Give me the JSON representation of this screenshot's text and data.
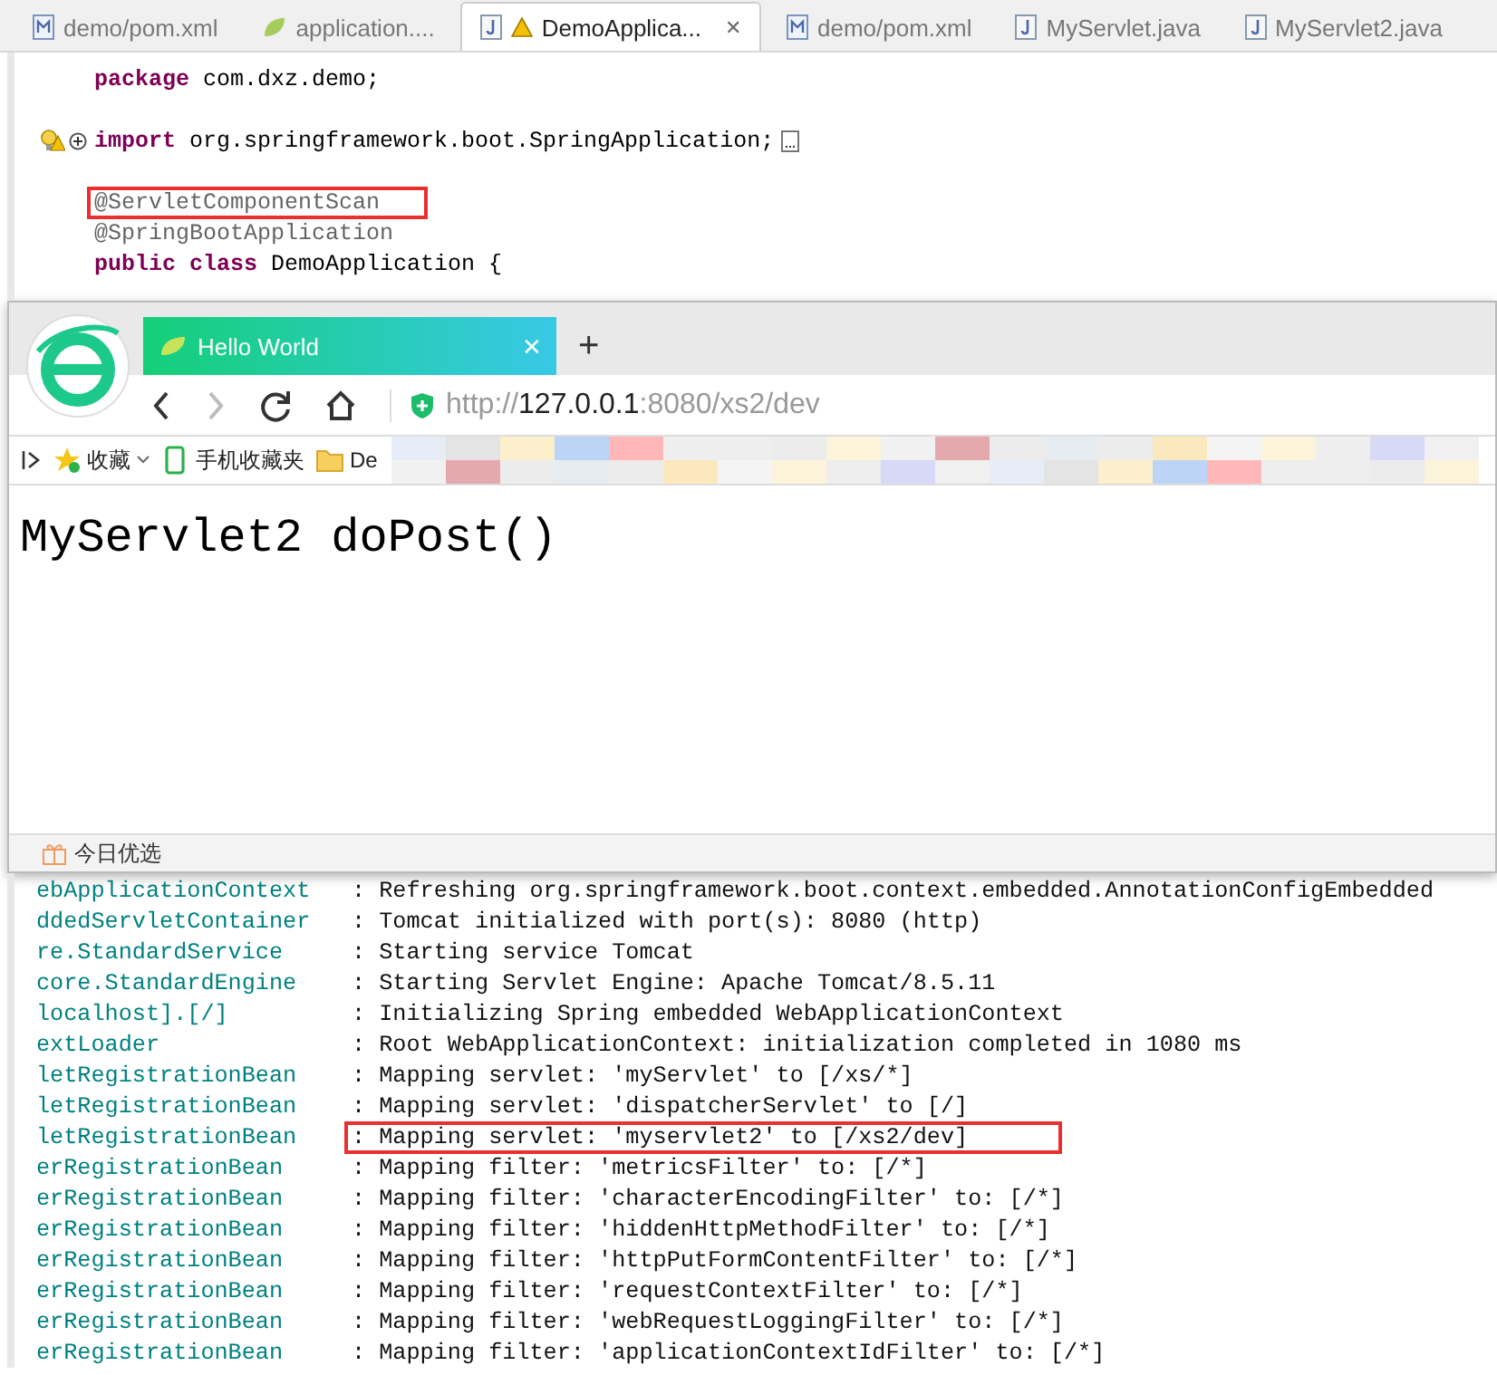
{
  "editor": {
    "tabs": [
      {
        "label": "demo/pom.xml",
        "kind": "maven",
        "selected": false,
        "warning": false
      },
      {
        "label": "application....",
        "kind": "spring",
        "selected": false,
        "warning": false
      },
      {
        "label": "DemoApplica...",
        "kind": "java",
        "selected": true,
        "warning": true,
        "close": "✕"
      },
      {
        "label": "demo/pom.xml",
        "kind": "maven",
        "selected": false,
        "warning": false
      },
      {
        "label": "MyServlet.java",
        "kind": "java",
        "selected": false,
        "warning": false
      },
      {
        "label": "MyServlet2.java",
        "kind": "java",
        "selected": false,
        "warning": false
      }
    ],
    "code_lines": [
      {
        "kind": "code",
        "segments": [
          {
            "text": "package",
            "kind": "keyword"
          },
          {
            "text": " com.dxz.demo;",
            "kind": "plain"
          }
        ],
        "highlighted": false
      },
      {
        "kind": "blank"
      },
      {
        "kind": "code",
        "segments": [
          {
            "text": "import",
            "kind": "keyword"
          },
          {
            "text": " org.springframework.boot.SpringApplication;",
            "kind": "plain"
          }
        ],
        "folded": true,
        "warning": true,
        "highlighted": false
      },
      {
        "kind": "blank"
      },
      {
        "kind": "code",
        "segments": [
          {
            "text": "@ServletComponentScan",
            "kind": "annotation"
          }
        ],
        "highlighted": true
      },
      {
        "kind": "code",
        "segments": [
          {
            "text": "@SpringBootApplication",
            "kind": "annotation"
          }
        ],
        "highlighted": false
      },
      {
        "kind": "code",
        "segments": [
          {
            "text": "public class",
            "kind": "keyword"
          },
          {
            "text": " DemoApplication {",
            "kind": "plain"
          }
        ],
        "highlighted": false
      }
    ]
  },
  "browser": {
    "tab": {
      "title": "Hello World",
      "close": "✕"
    },
    "new_tab": "+",
    "url": [
      {
        "text": "http://",
        "kind": "dim"
      },
      {
        "text": "127.0.0.1",
        "kind": "host"
      },
      {
        "text": ":8080/xs2/dev",
        "kind": "dim"
      }
    ],
    "bookmarks": [
      {
        "label": "收藏",
        "kind": "star"
      },
      {
        "label": "手机收藏夹",
        "kind": "phone"
      },
      {
        "label": "De",
        "kind": "folder"
      }
    ],
    "content": "MyServlet2 doPost()",
    "status": "今日优选"
  },
  "console": {
    "lines": [
      {
        "source": "ebApplicationContext",
        "message": ": Refreshing org.springframework.boot.context.embedded.AnnotationConfigEmbedded",
        "highlighted": false
      },
      {
        "source": "ddedServletContainer",
        "message": ": Tomcat initialized with port(s): 8080 (http)",
        "highlighted": false
      },
      {
        "source": "re.StandardService",
        "message": ": Starting service Tomcat",
        "highlighted": false
      },
      {
        "source": "core.StandardEngine",
        "message": ": Starting Servlet Engine: Apache Tomcat/8.5.11",
        "highlighted": false
      },
      {
        "source": "localhost].[/]",
        "message": ": Initializing Spring embedded WebApplicationContext",
        "highlighted": false
      },
      {
        "source": "extLoader",
        "message": ": Root WebApplicationContext: initialization completed in 1080 ms",
        "highlighted": false
      },
      {
        "source": "letRegistrationBean",
        "message": ": Mapping servlet: 'myServlet' to [/xs/*]",
        "highlighted": false
      },
      {
        "source": "letRegistrationBean",
        "message": ": Mapping servlet: 'dispatcherServlet' to [/]",
        "highlighted": false
      },
      {
        "source": "letRegistrationBean",
        "message": ": Mapping servlet: 'myservlet2' to [/xs2/dev]",
        "highlighted": true
      },
      {
        "source": "erRegistrationBean",
        "message": ": Mapping filter: 'metricsFilter' to: [/*]",
        "highlighted": false
      },
      {
        "source": "erRegistrationBean",
        "message": ": Mapping filter: 'characterEncodingFilter' to: [/*]",
        "highlighted": false
      },
      {
        "source": "erRegistrationBean",
        "message": ": Mapping filter: 'hiddenHttpMethodFilter' to: [/*]",
        "highlighted": false
      },
      {
        "source": "erRegistrationBean",
        "message": ": Mapping filter: 'httpPutFormContentFilter' to: [/*]",
        "highlighted": false
      },
      {
        "source": "erRegistrationBean",
        "message": ": Mapping filter: 'requestContextFilter' to: [/*]",
        "highlighted": false
      },
      {
        "source": "erRegistrationBean",
        "message": ": Mapping filter: 'webRequestLoggingFilter' to: [/*]",
        "highlighted": false
      },
      {
        "source": "erRegistrationBean",
        "message": ": Mapping filter: 'applicationContextIdFilter' to: [/*]",
        "highlighted": false
      }
    ]
  }
}
